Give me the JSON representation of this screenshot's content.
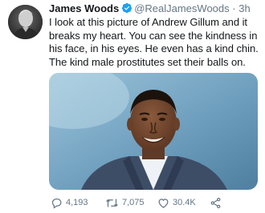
{
  "tweet": {
    "author_name": "James Woods",
    "handle": "@RealJamesWoods",
    "separator": "·",
    "time": "3h",
    "text": "I look at this picture of Andrew Gillum and it breaks my heart. You can see the kindness in his face, in his eyes. He even has a kind chin. The kind male prostitutes set their balls on.",
    "verified": true
  },
  "actions": {
    "replies": "4,193",
    "retweets": "7,075",
    "likes": "30.4K"
  },
  "icons": {
    "verified": "verified-badge-icon",
    "reply": "reply-icon",
    "retweet": "retweet-icon",
    "like": "heart-icon",
    "share": "share-icon"
  },
  "colors": {
    "verified_blue": "#1da1f2",
    "secondary_text": "#657786",
    "primary_text": "#14171a"
  }
}
